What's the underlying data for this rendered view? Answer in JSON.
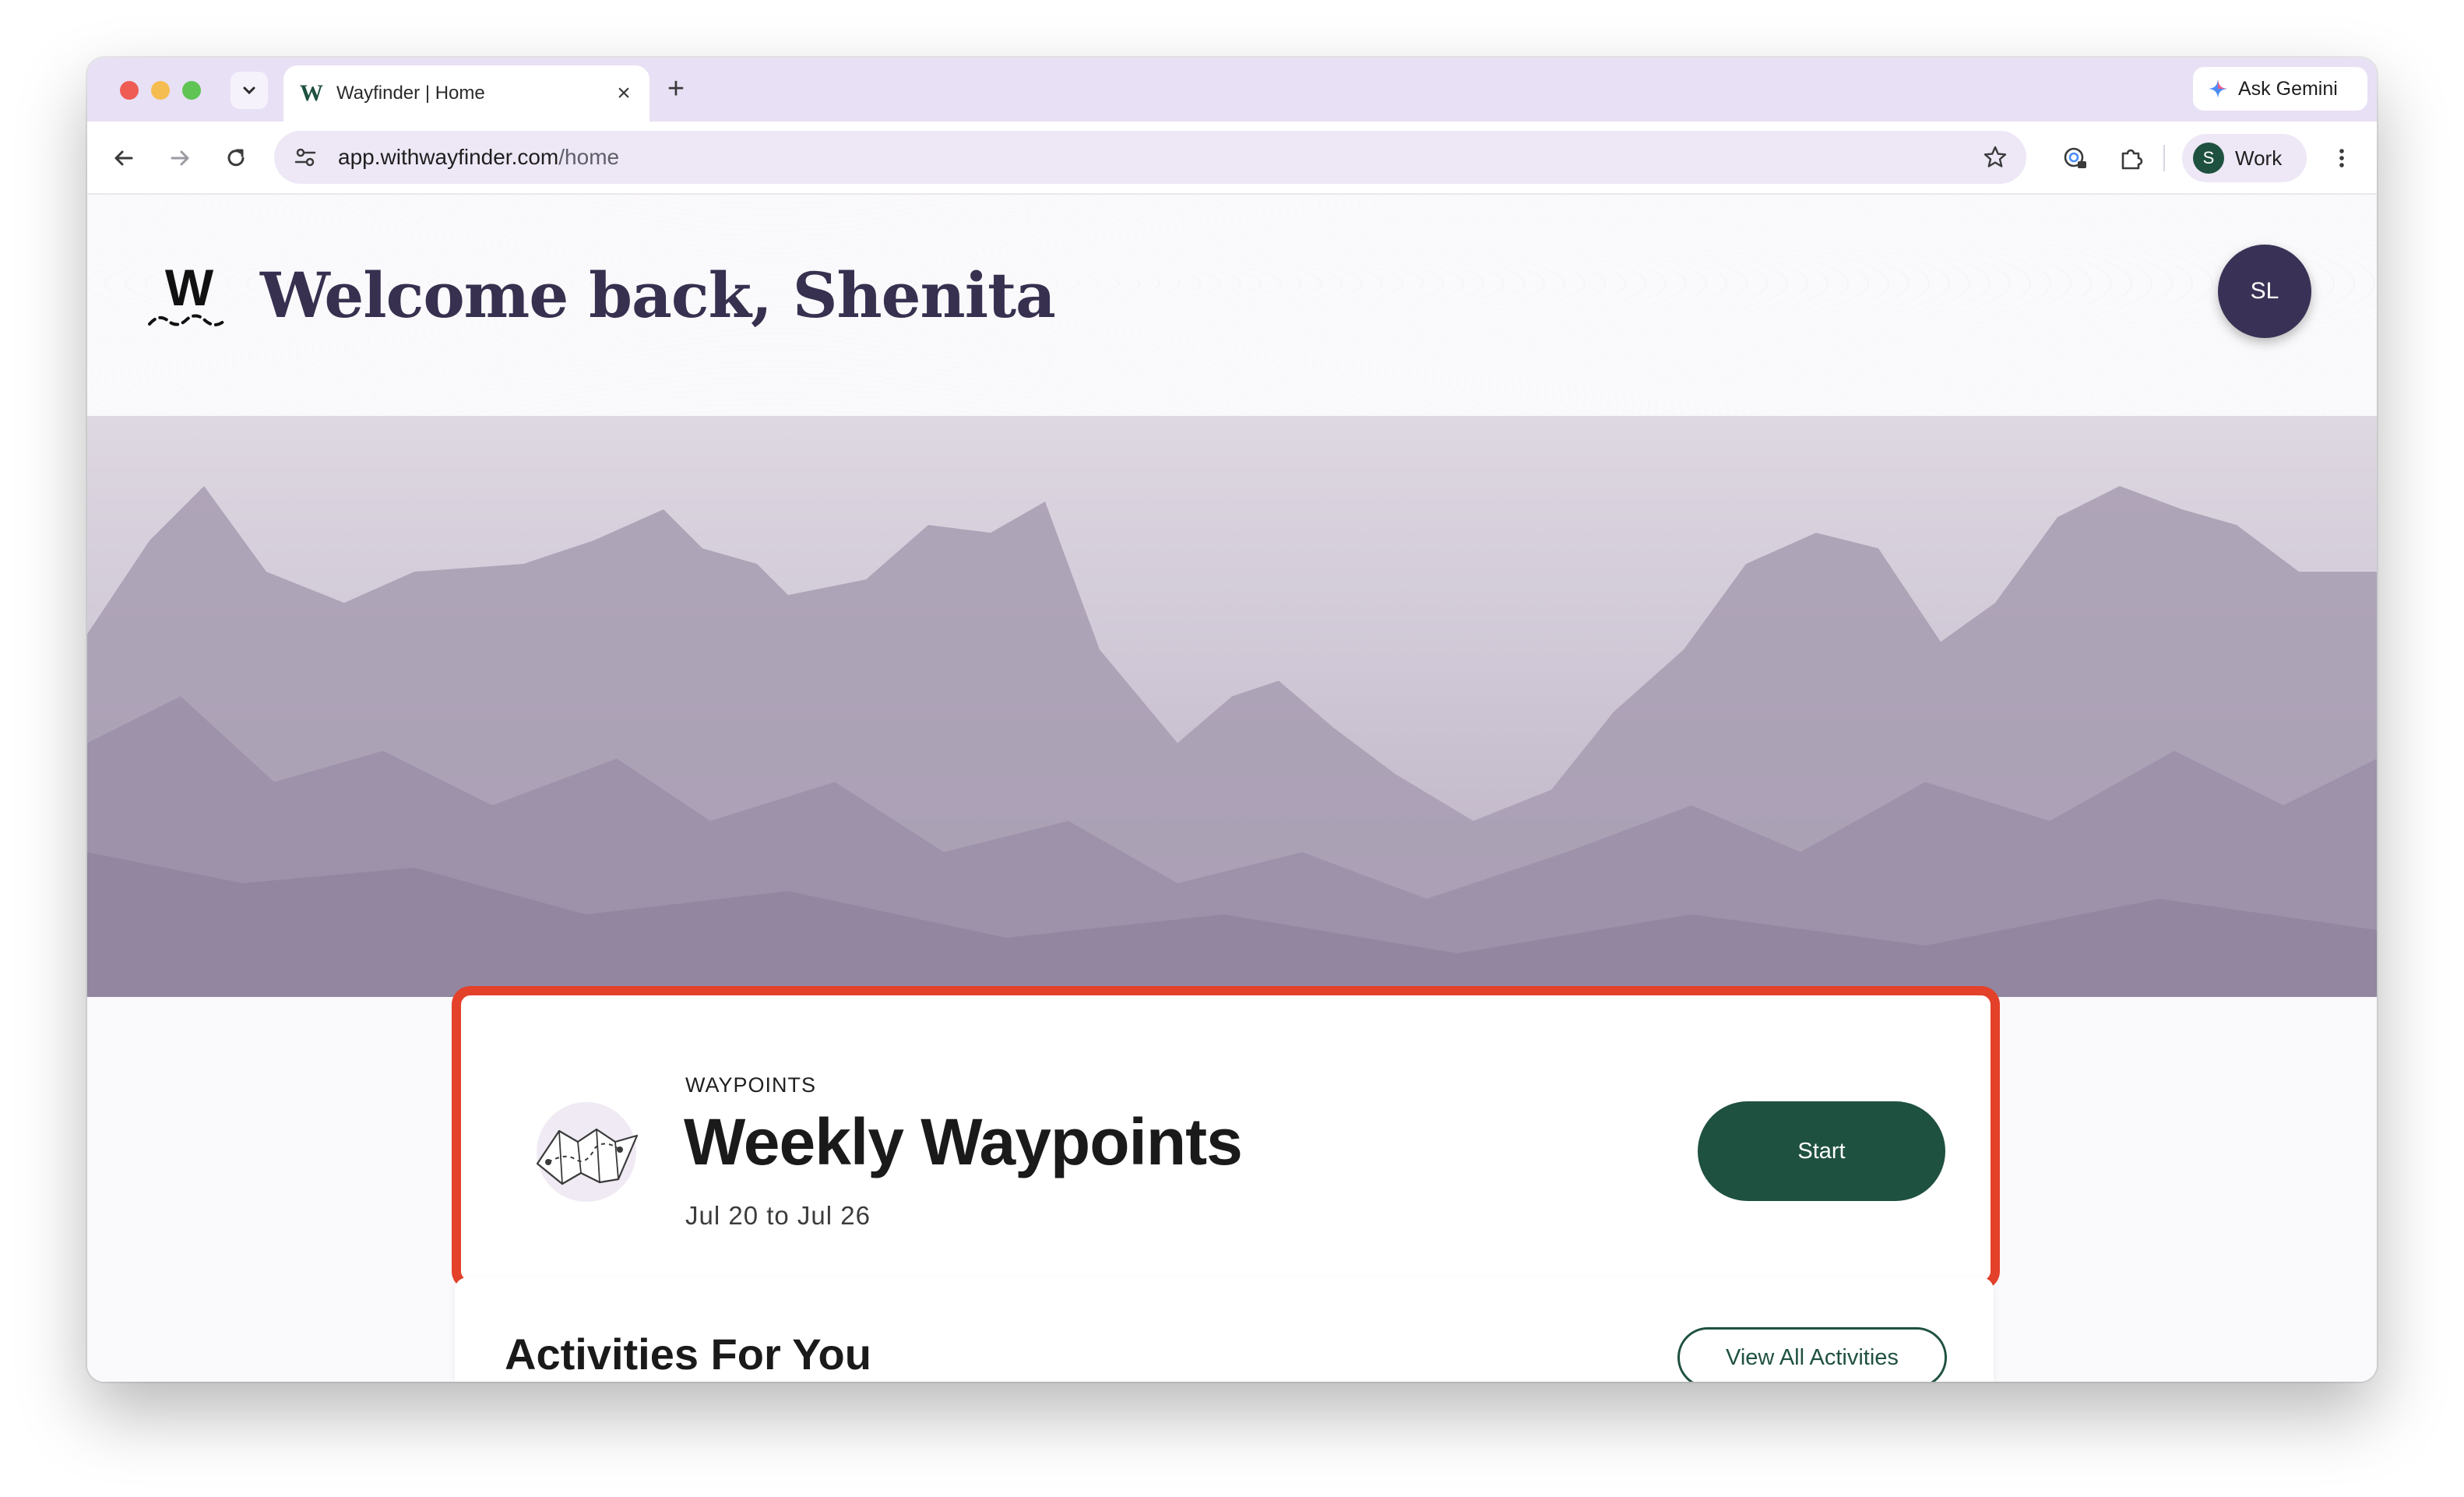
{
  "browser": {
    "tab": {
      "title": "Wayfinder | Home",
      "favicon_letter": "W"
    },
    "gemini_label": "Ask Gemini",
    "url": {
      "host": "app.withwayfinder.com",
      "path": "/home"
    },
    "profile": {
      "initial": "S",
      "label": "Work"
    },
    "icons": [
      "chevron-down-icon",
      "close-icon",
      "plus-icon",
      "gemini-sparkle-icon",
      "back-arrow-icon",
      "forward-arrow-icon",
      "reload-icon",
      "site-settings-icon",
      "star-icon",
      "password-manager-icon",
      "extensions-icon",
      "more-vert-icon"
    ]
  },
  "header": {
    "logo_letter": "W",
    "welcome": "Welcome back, Shenita",
    "avatar_initials": "SL"
  },
  "waypoints": {
    "eyebrow": "WAYPOINTS",
    "title": "Weekly Waypoints",
    "dates": "Jul 20 to Jul 26",
    "start_label": "Start",
    "highlight_color": "#e3412a"
  },
  "activities": {
    "title": "Activities For You",
    "view_all_label": "View All Activities"
  },
  "colors": {
    "brand_green": "#1f5140",
    "heading_purple": "#37304f",
    "tab_strip": "#e8e0f5"
  }
}
